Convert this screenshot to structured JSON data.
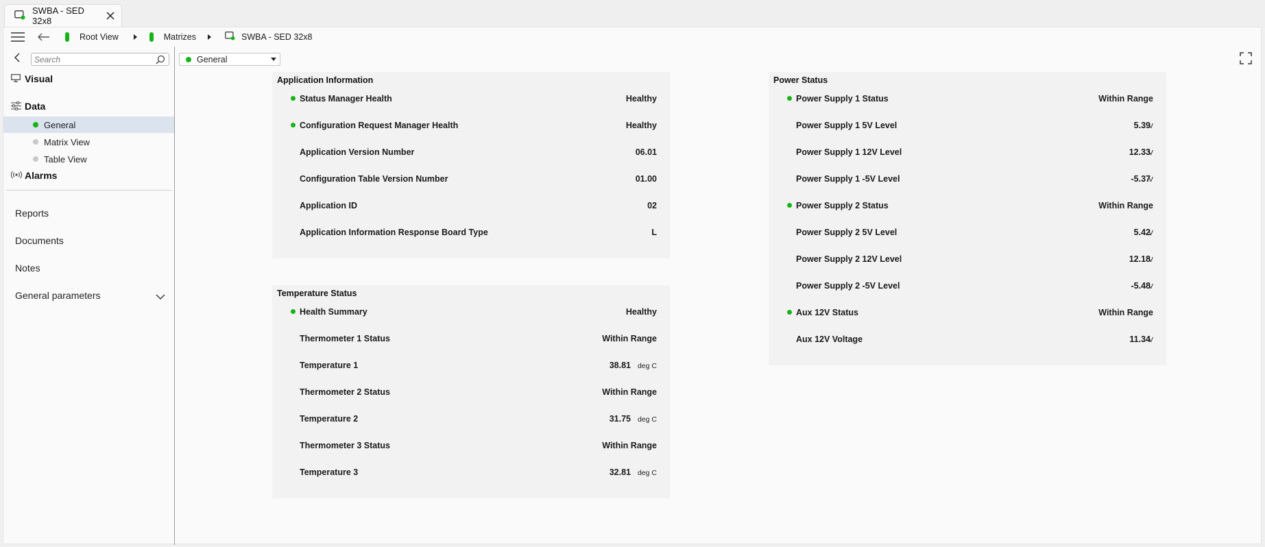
{
  "tab": {
    "title": "SWBA - SED 32x8"
  },
  "breadcrumb": [
    {
      "label": "Root View"
    },
    {
      "label": "Matrizes"
    },
    {
      "label": "SWBA - SED 32x8"
    }
  ],
  "sidebar": {
    "search_placeholder": "Search",
    "visual_label": "Visual",
    "data_label": "Data",
    "data_items": [
      {
        "label": "General",
        "status": "ok"
      },
      {
        "label": "Matrix View",
        "status": "none"
      },
      {
        "label": "Table View",
        "status": "none"
      }
    ],
    "alarms_label": "Alarms",
    "links": [
      {
        "label": "Reports"
      },
      {
        "label": "Documents"
      },
      {
        "label": "Notes"
      },
      {
        "label": "General parameters"
      }
    ]
  },
  "view_selector": {
    "value": "General"
  },
  "panels": {
    "application": {
      "title": "Application Information",
      "rows": [
        {
          "label": "Status Manager Health",
          "value": "Healthy",
          "unit": "",
          "dot": true
        },
        {
          "label": "Configuration Request Manager Health",
          "value": "Healthy",
          "unit": "",
          "dot": true
        },
        {
          "label": "Application Version Number",
          "value": "06.01",
          "unit": "",
          "dot": false
        },
        {
          "label": "Configuration Table Version Number",
          "value": "01.00",
          "unit": "",
          "dot": false
        },
        {
          "label": "Application ID",
          "value": "02",
          "unit": "",
          "dot": false
        },
        {
          "label": "Application Information Response Board Type",
          "value": "L",
          "unit": "",
          "dot": false
        }
      ]
    },
    "temperature": {
      "title": "Temperature Status",
      "rows": [
        {
          "label": "Health Summary",
          "value": "Healthy",
          "unit": "",
          "dot": true
        },
        {
          "label": "Thermometer 1 Status",
          "value": "Within Range",
          "unit": "",
          "dot": false
        },
        {
          "label": "Temperature 1",
          "value": "38.81",
          "unit": "deg C",
          "dot": false
        },
        {
          "label": "Thermometer 2 Status",
          "value": "Within Range",
          "unit": "",
          "dot": false
        },
        {
          "label": "Temperature 2",
          "value": "31.75",
          "unit": "deg C",
          "dot": false
        },
        {
          "label": "Thermometer 3 Status",
          "value": "Within Range",
          "unit": "",
          "dot": false
        },
        {
          "label": "Temperature 3",
          "value": "32.81",
          "unit": "deg C",
          "dot": false
        }
      ]
    },
    "power": {
      "title": "Power Status",
      "rows": [
        {
          "label": "Power Supply 1 Status",
          "value": "Within Range",
          "unit": "",
          "dot": true
        },
        {
          "label": "Power Supply 1 5V Level",
          "value": "5.39",
          "unit": "V",
          "dot": false
        },
        {
          "label": "Power Supply 1 12V Level",
          "value": "12.33",
          "unit": "V",
          "dot": false
        },
        {
          "label": "Power Supply 1 -5V Level",
          "value": "-5.37",
          "unit": "V",
          "dot": false
        },
        {
          "label": "Power Supply 2 Status",
          "value": "Within Range",
          "unit": "",
          "dot": true
        },
        {
          "label": "Power Supply 2 5V Level",
          "value": "5.42",
          "unit": "V",
          "dot": false
        },
        {
          "label": "Power Supply 2 12V Level",
          "value": "12.18",
          "unit": "V",
          "dot": false
        },
        {
          "label": "Power Supply 2 -5V Level",
          "value": "-5.48",
          "unit": "V",
          "dot": false
        },
        {
          "label": "Aux 12V Status",
          "value": "Within Range",
          "unit": "",
          "dot": true
        },
        {
          "label": "Aux 12V Voltage",
          "value": "11.34",
          "unit": "V",
          "dot": false
        }
      ]
    }
  },
  "colors": {
    "status_ok": "#16b416",
    "selected_bg": "#dbe3ee",
    "panel_bg": "#f2f2f2"
  }
}
